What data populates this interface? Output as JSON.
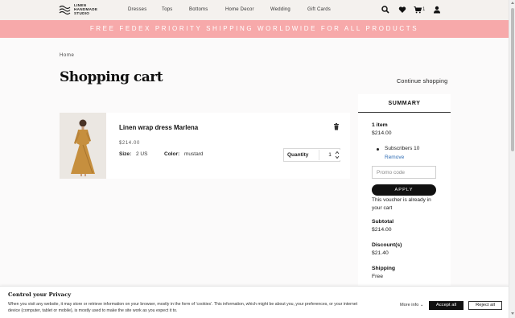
{
  "header": {
    "logo_text": [
      "LINEN",
      "HANDMADE",
      "STUDIO"
    ],
    "nav": [
      "Dresses",
      "Tops",
      "Bottoms",
      "Home Decor",
      "Wedding",
      "Gift Cards"
    ],
    "icons": [
      "search-icon",
      "wishlist-heart-icon",
      "cart-icon",
      "account-icon"
    ],
    "cart_count": "1"
  },
  "promo_banner": "FREE FEDEX PRIORITY SHIPPING WORLDWIDE FOR ALL PRODUCTS",
  "breadcrumb": "Home",
  "page_title": "Shopping cart",
  "continue_shopping": "Continue shopping",
  "cart_item": {
    "name": "Linen wrap dress Marlena",
    "price": "$214.00",
    "size_label": "Size:",
    "size_value": "2 US",
    "color_label": "Color:",
    "color_value": "mustard",
    "quantity_label": "Quantity",
    "quantity_value": "1",
    "delete_icon": "trash-icon"
  },
  "summary": {
    "title": "SUMMARY",
    "item_count": "1 item",
    "item_total": "$214.00",
    "subscriber": "Subscribers 10",
    "remove": "Remove",
    "promo_placeholder": "Promo code",
    "apply": "APPLY",
    "voucher_message": "This voucher is already in your cart",
    "subtotal_label": "Subtotal",
    "subtotal_value": "$214.00",
    "discount_label": "Discount(s)",
    "discount_value": "$21.40",
    "shipping_label": "Shipping",
    "shipping_value": "Free"
  },
  "cookie": {
    "title": "Control your Privacy",
    "text": "When you visit any website, it may store or retrieve information on your browser, mostly in the form of 'cookies'. This information, which might be about you, your preferences, or your internet device (computer, tablet or mobile), is mostly used to make the site work as you expect it to.",
    "more_info": "More info",
    "accept": "Accept all",
    "reject": "Reject all"
  },
  "colors": {
    "promo_banner_bg": "#f7a9aa",
    "header_bg": "#f4f1ee",
    "button_dark": "#111111",
    "link_blue": "#2f6db5",
    "dress_mustard": "#c68f3e"
  }
}
